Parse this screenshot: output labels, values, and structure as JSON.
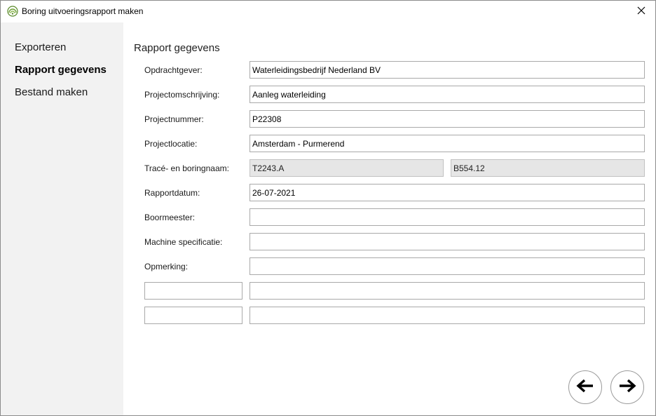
{
  "window": {
    "title": "Boring uitvoeringsrapport maken"
  },
  "sidebar": {
    "items": [
      {
        "label": "Exporteren",
        "active": false
      },
      {
        "label": "Rapport gegevens",
        "active": true
      },
      {
        "label": "Bestand maken",
        "active": false
      }
    ]
  },
  "main": {
    "section_title": "Rapport gegevens",
    "fields": {
      "opdrachtgever": {
        "label": "Opdrachtgever:",
        "value": "Waterleidingsbedrijf Nederland BV"
      },
      "projectomschrijving": {
        "label": "Projectomschrijving:",
        "value": "Aanleg waterleiding"
      },
      "projectnummer": {
        "label": "Projectnummer:",
        "value": "P22308"
      },
      "projectlocatie": {
        "label": "Projectlocatie:",
        "value": "Amsterdam - Purmerend"
      },
      "trace": {
        "label": "Tracé- en boringnaam:",
        "trace_value": "T2243.A",
        "boring_value": "B554.12"
      },
      "rapportdatum": {
        "label": "Rapportdatum:",
        "value": "26-07-2021"
      },
      "boormeester": {
        "label": "Boormeester:",
        "value": ""
      },
      "machine": {
        "label": "Machine specificatie:",
        "value": ""
      },
      "opmerking": {
        "label": "Opmerking:",
        "value": ""
      },
      "custom1": {
        "name_value": "",
        "value": ""
      },
      "custom2": {
        "name_value": "",
        "value": ""
      }
    }
  },
  "icons": {
    "app": "drill-logo-icon",
    "close": "close-icon",
    "back": "arrow-left-icon",
    "next": "arrow-right-icon"
  },
  "colors": {
    "sidebar_bg": "#f2f2f2",
    "readonly_bg": "#e6e6e6",
    "logo_green": "#5a8a2a"
  }
}
